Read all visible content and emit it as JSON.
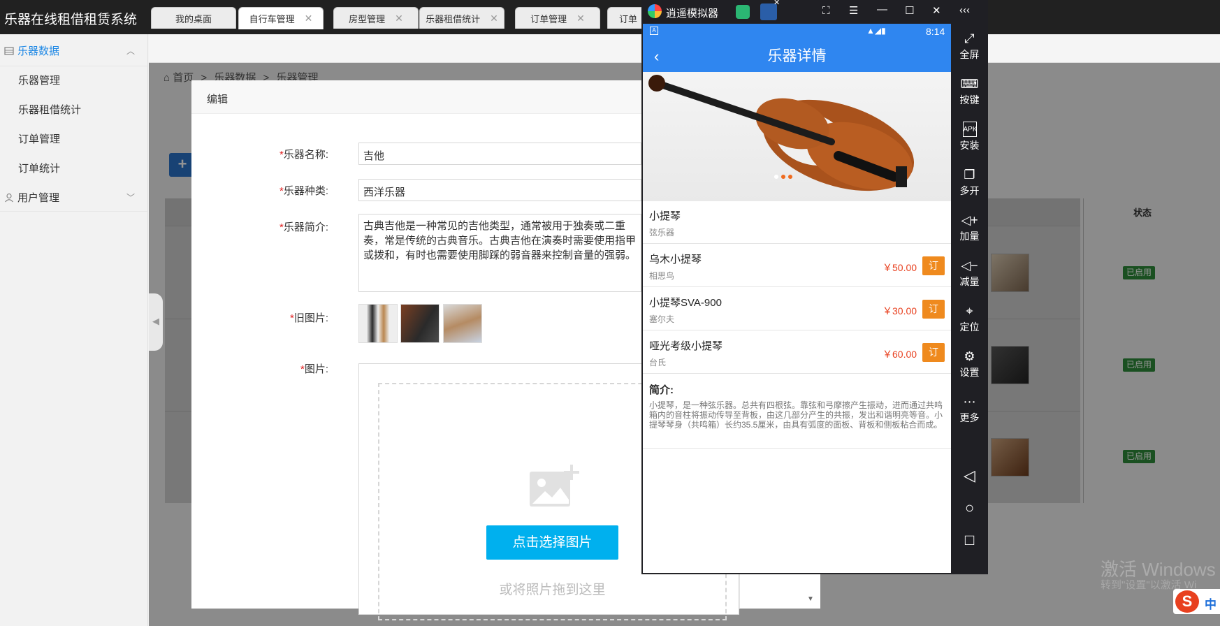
{
  "app": {
    "title": "乐器在线租借租赁系统"
  },
  "sidebar": {
    "groups": [
      {
        "label": "乐器数据",
        "items": [
          "乐器管理",
          "乐器租借统计",
          "订单管理",
          "订单统计"
        ]
      },
      {
        "label": "用户管理",
        "items": []
      }
    ]
  },
  "tabs": [
    {
      "label": "我的桌面"
    },
    {
      "label": "自行车管理"
    },
    {
      "label": "房型管理"
    },
    {
      "label": "乐器租借统计"
    },
    {
      "label": "订单管理"
    },
    {
      "label": "订单"
    }
  ],
  "breadcrumb": [
    "首页",
    "乐器数据",
    "乐器管理"
  ],
  "breadcrumb_sep": ">",
  "background_table": {
    "status_header": "状态",
    "rows": [
      {
        "status": "已启用"
      },
      {
        "status": "已启用"
      },
      {
        "status": "已启用"
      }
    ]
  },
  "add_button": "+",
  "modal": {
    "title": "编辑",
    "required_mark": "*",
    "fields": {
      "name_label": "乐器名称:",
      "name_value": "吉他",
      "type_label": "乐器种类:",
      "type_value": "西洋乐器",
      "desc_label": "乐器简介:",
      "desc_value": "古典吉他是一种常见的吉他类型，通常被用于独奏或二重奏，常是传统的古典音乐。古典吉他在演奏时需要使用指甲或拨和，有时也需要使用脚踩的弱音器来控制音量的强弱。",
      "old_images_label": "旧图片:",
      "image_label": "图片:"
    },
    "upload": {
      "button": "点击选择图片",
      "hint": "或将照片拖到这里"
    }
  },
  "emulator": {
    "title": "逍遥模拟器",
    "status_time": "8:14",
    "rail": [
      "全屏",
      "按键",
      "安装",
      "多开",
      "加量",
      "减量",
      "定位",
      "设置",
      "更多"
    ],
    "rail_apk": "APK"
  },
  "phone": {
    "header": "乐器详情",
    "hero": {
      "name": "小提琴",
      "category": "弦乐器"
    },
    "products": [
      {
        "name": "乌木小提琴",
        "brand": "相思鸟",
        "price": "￥50.00",
        "order": "订"
      },
      {
        "name": "小提琴SVA-900",
        "brand": "塞尔夫",
        "price": "￥30.00",
        "order": "订"
      },
      {
        "name": "哑光考级小提琴",
        "brand": "台氏",
        "price": "￥60.00",
        "order": "订"
      }
    ],
    "intro_title": "简介:",
    "intro_text": "小提琴，是一种弦乐器。总共有四根弦。靠弦和弓摩擦产生振动，进而通过共鸣箱内的音柱将振动传导至背板，由这几部分产生的共振，发出和谐明亮等音。小提琴琴身（共鸣箱）长约35.5厘米，由具有弧度的面板、背板和侧板粘合而成。"
  },
  "watermark": {
    "line1": "激活 Windows",
    "line2": "转到\"设置\"以激活 Wi"
  },
  "ime": {
    "label": "中"
  },
  "colors": {
    "accent": "#2f86f0",
    "order": "#ef8a1e",
    "price": "#e8401f",
    "enabled": "#2e8b3a",
    "upload": "#00b0ee"
  }
}
